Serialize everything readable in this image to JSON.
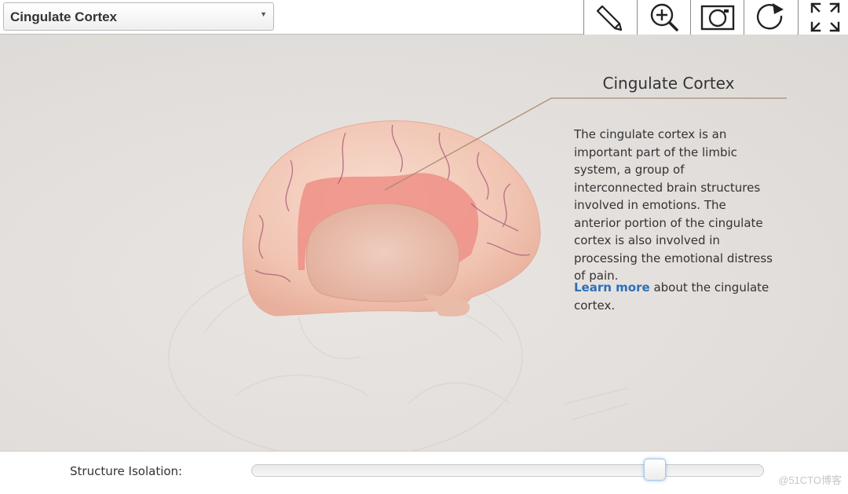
{
  "structure_select": {
    "selected": "Cingulate Cortex"
  },
  "toolbar": {
    "tools": [
      {
        "name": "pencil-icon"
      },
      {
        "name": "zoom-in-icon"
      },
      {
        "name": "camera-icon"
      },
      {
        "name": "rotate-icon"
      },
      {
        "name": "fullscreen-icon"
      }
    ]
  },
  "info": {
    "title": "Cingulate Cortex",
    "description": "The cingulate cortex is an important part of the limbic system, a group of interconnected brain structures involved in emotions. The anterior portion of the cingulate cortex is also involved in processing the emotional distress of pain.",
    "learn_more_link": "Learn more",
    "learn_more_suffix": " about the cingulate cortex."
  },
  "isolation": {
    "label": "Structure Isolation:",
    "value_fraction": 0.8
  },
  "watermark": "@51CTO博客",
  "colors": {
    "link": "#2c6fb7",
    "leader_line": "#a88e72",
    "highlight": "#ef8f86"
  }
}
